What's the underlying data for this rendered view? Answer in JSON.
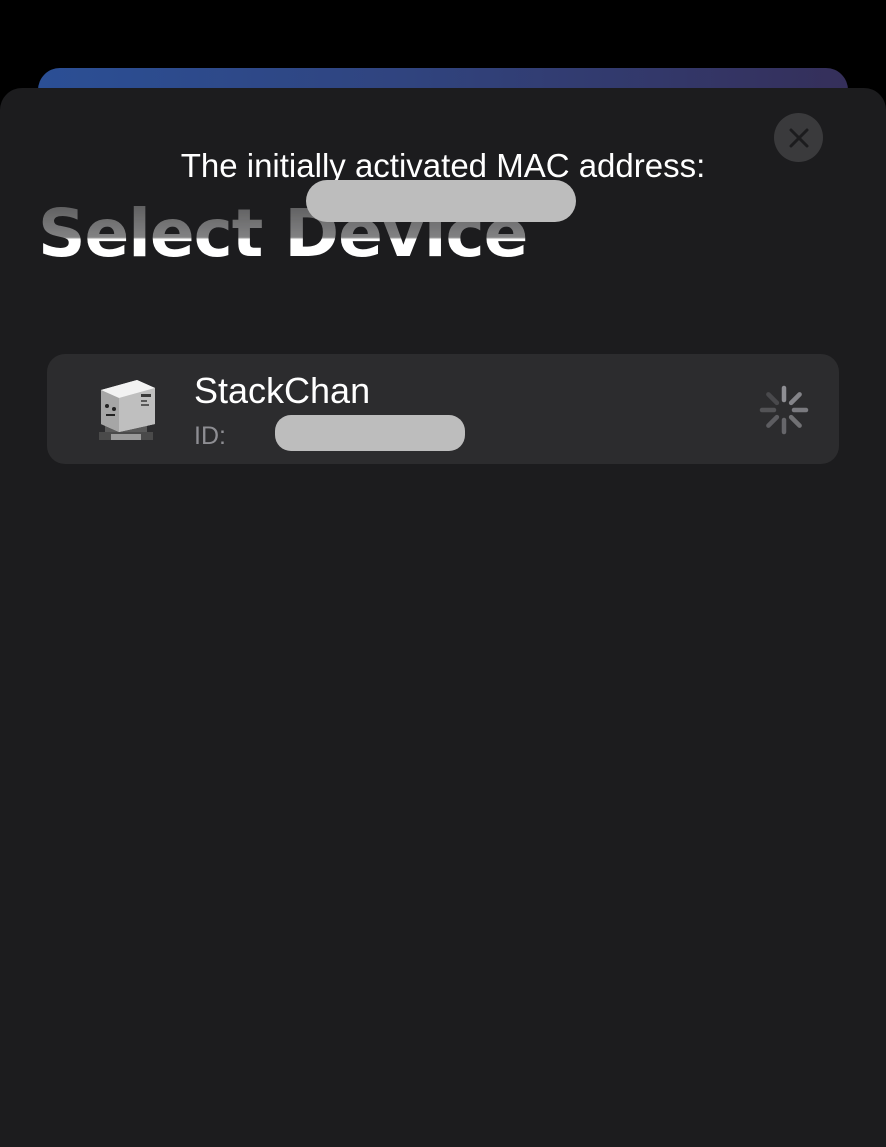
{
  "background_card": {
    "gradient_colors": [
      "#2b4f95",
      "#352f5a"
    ]
  },
  "sheet": {
    "title": "Select Device",
    "background_color": "#1c1c1e",
    "close_icon": "close-icon"
  },
  "toast": {
    "text": "The initially activated MAC address:"
  },
  "devices": [
    {
      "name": "StackChan",
      "id_label": "ID:",
      "thumbnail_icon": "stackchan-device-image",
      "status_icon": "loading-spinner-icon"
    }
  ],
  "colors": {
    "row_background": "#2c2c2e",
    "secondary_text": "#8e8e93",
    "redaction": "#bdbdbd"
  }
}
